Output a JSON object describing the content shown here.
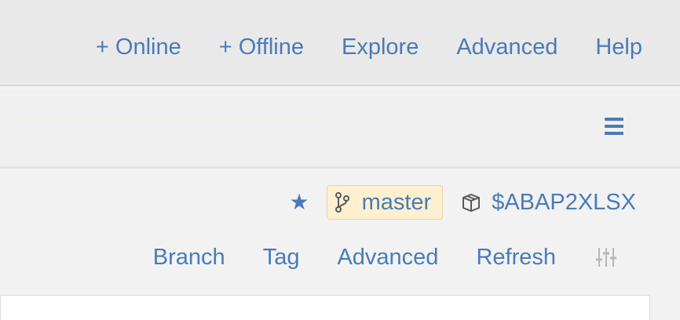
{
  "top_menu": {
    "online": "+ Online",
    "offline": "+ Offline",
    "explore": "Explore",
    "advanced": "Advanced",
    "help": "Help"
  },
  "repo": {
    "branch": "master",
    "package": "$ABAP2XLSX"
  },
  "actions": {
    "branch": "Branch",
    "tag": "Tag",
    "advanced": "Advanced",
    "refresh": "Refresh"
  },
  "colors": {
    "link": "#4a7bb8",
    "branch_pill_bg": "#fcf0d0",
    "branch_pill_border": "#e8d6a2"
  },
  "icons": {
    "menu": "hamburger-icon",
    "favorite": "star-icon",
    "branch": "git-branch-icon",
    "package": "package-icon",
    "settings": "settings-sliders-icon"
  }
}
